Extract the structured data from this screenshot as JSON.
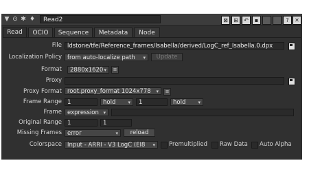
{
  "header": {
    "node_name": "Read2"
  },
  "tabs": [
    {
      "label": "Read"
    },
    {
      "label": "OCIO"
    },
    {
      "label": "Sequence"
    },
    {
      "label": "Metadata"
    },
    {
      "label": "Node"
    }
  ],
  "fields": {
    "file_label": "File",
    "file_value": "ldstone/tfe/Reference_frames/Isabella/derived/LogC_ref_Isabella.0.dpx",
    "localization_label": "Localization Policy",
    "localization_value": "from auto-localize path",
    "update_label": "Update",
    "format_label": "Format",
    "format_value": "2880x1620",
    "proxy_label": "Proxy",
    "proxy_value": "",
    "proxy_format_label": "Proxy Format",
    "proxy_format_value": "root.proxy_format 1024x778",
    "frame_range_label": "Frame Range",
    "frame_range_start": "1",
    "frame_range_start_mode": "hold",
    "frame_range_end": "1",
    "frame_range_end_mode": "hold",
    "frame_label": "Frame",
    "frame_mode": "expression",
    "frame_value": "",
    "original_range_label": "Original Range",
    "original_range_start": "1",
    "original_range_end": "1",
    "missing_frames_label": "Missing Frames",
    "missing_frames_value": "error",
    "reload_label": "reload",
    "colorspace_label": "Colorspace",
    "colorspace_value": "Input - ARRI - V3 LogC (EI8",
    "premultiplied_label": "Premultiplied",
    "raw_data_label": "Raw Data",
    "auto_alpha_label": "Auto Alpha"
  },
  "icons": {
    "menu": "menu-arrow-icon",
    "pin": "pin-icon",
    "node_type": "read-node-icon",
    "file_browse": "file-browse-icon"
  },
  "colors": {
    "panel_bg": "#303030",
    "field_bg": "#2a2a2a",
    "text": "#d6d6d6"
  }
}
